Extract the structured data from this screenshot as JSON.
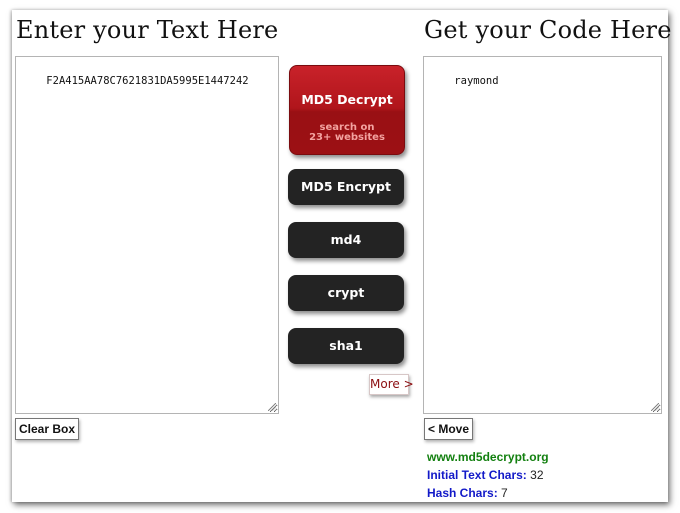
{
  "left": {
    "heading": "Enter your Text Here",
    "textarea_value": "F2A415AA78C7621831DA5995E1447242",
    "clear_label": "Clear Box"
  },
  "center": {
    "decrypt": {
      "label": "MD5 Decrypt",
      "sub_line1": "search on",
      "sub_line2": "23+ websites"
    },
    "buttons": [
      {
        "label": "MD5 Encrypt"
      },
      {
        "label": "md4"
      },
      {
        "label": "crypt"
      },
      {
        "label": "sha1"
      }
    ],
    "more_label": "More >"
  },
  "right": {
    "heading": "Get your Code Here",
    "textarea_value": "raymond",
    "move_label": "< Move",
    "site": "www.md5decrypt.org",
    "initial_label": "Initial Text Chars:",
    "initial_value": "32",
    "hash_label": "Hash Chars:",
    "hash_value": "7"
  },
  "colors": {
    "decrypt_red": "#b0151b",
    "dark_button": "#232323",
    "site_green": "#138010",
    "label_blue": "#1219c8",
    "more_red": "#8b0d10"
  }
}
